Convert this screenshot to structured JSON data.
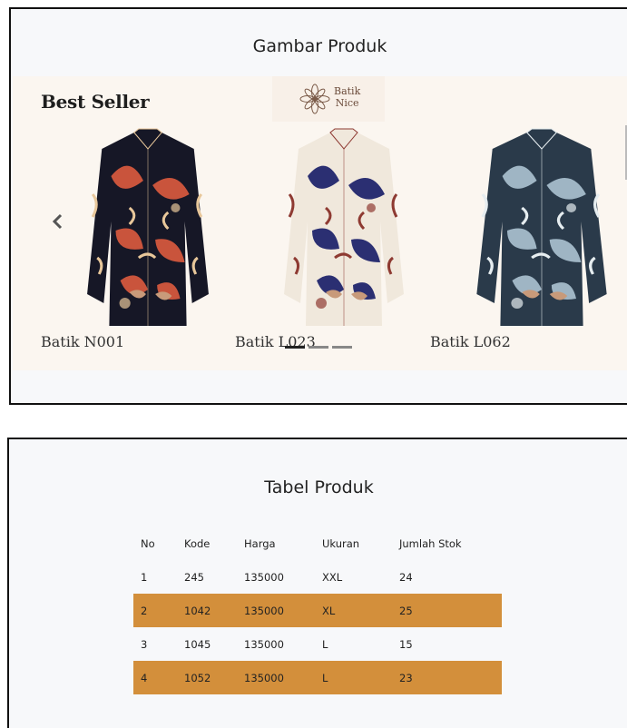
{
  "gallery": {
    "title": "Gambar Produk",
    "carousel": {
      "heading": "Best Seller",
      "logo": {
        "line1": "Batik",
        "line2": "Nice"
      },
      "items": [
        {
          "name": "Batik N001",
          "colors": {
            "base": "#161726",
            "pattern": "#c9543c",
            "accent": "#e8c79a"
          }
        },
        {
          "name": "Batik L023",
          "colors": {
            "base": "#f0e8dc",
            "pattern": "#2b2f72",
            "accent": "#8e3a32"
          }
        },
        {
          "name": "Batik L062",
          "colors": {
            "base": "#2a3a4a",
            "pattern": "#9fb5c4",
            "accent": "#e6edf0"
          }
        }
      ],
      "active_index": 0,
      "indicator_count": 3
    }
  },
  "table": {
    "title": "Tabel Produk",
    "headers": [
      "No",
      "Kode",
      "Harga",
      "Ukuran",
      "Jumlah Stok"
    ],
    "rows": [
      [
        "1",
        "245",
        "135000",
        "XXL",
        "24"
      ],
      [
        "2",
        "1042",
        "135000",
        "XL",
        "25"
      ],
      [
        "3",
        "1045",
        "135000",
        "L",
        "15"
      ],
      [
        "4",
        "1052",
        "135000",
        "L",
        "23"
      ]
    ],
    "stripe_color": "#d38f3b"
  }
}
